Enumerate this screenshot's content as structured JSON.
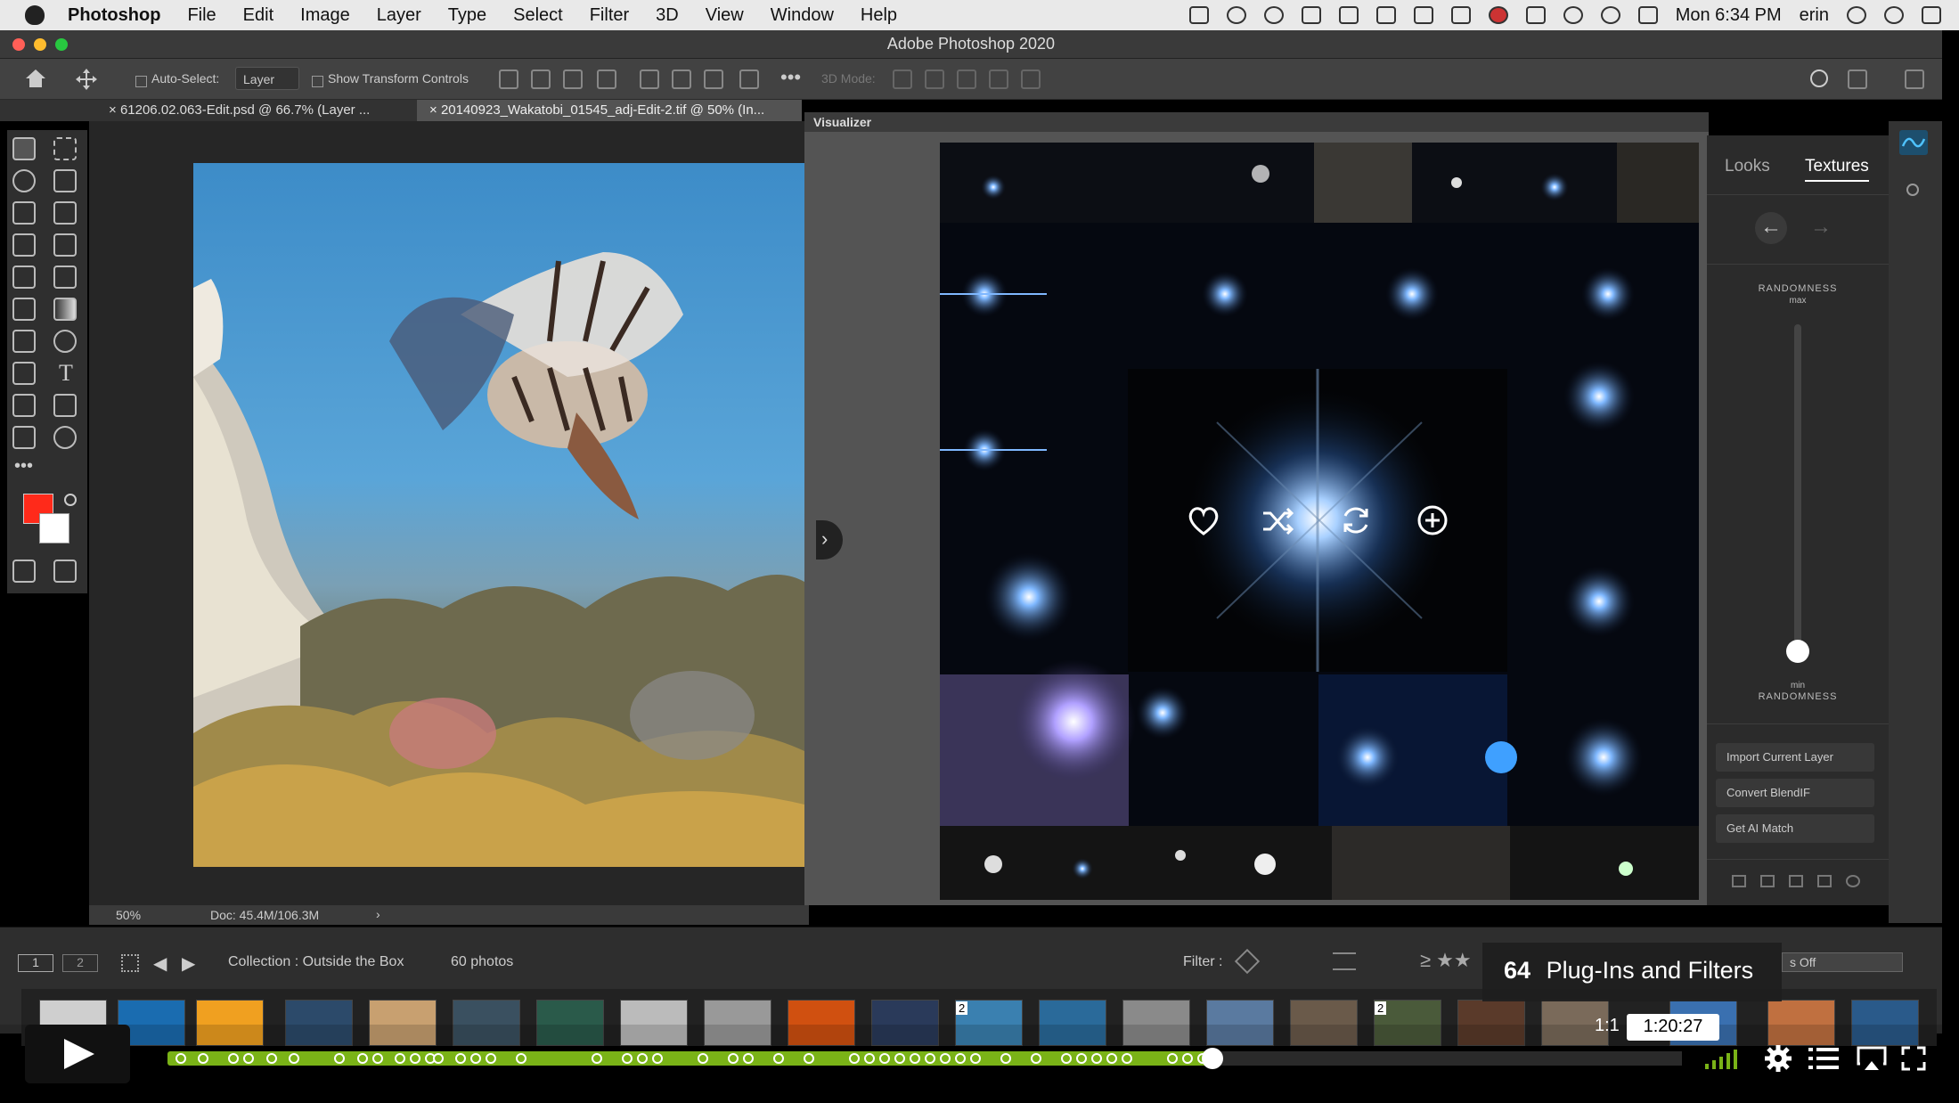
{
  "menubar": {
    "app_name": "Photoshop",
    "items": [
      "File",
      "Edit",
      "Image",
      "Layer",
      "Type",
      "Select",
      "Filter",
      "3D",
      "View",
      "Window",
      "Help"
    ],
    "clock": "Mon 6:34 PM",
    "user": "erin"
  },
  "window": {
    "title": "Adobe Photoshop 2020"
  },
  "options_bar": {
    "auto_select_label": "Auto-Select:",
    "auto_select_value": "Layer",
    "show_transform_label": "Show Transform Controls",
    "mode_3d_label": "3D Mode:"
  },
  "tabs": [
    {
      "label": "61206.02.063-Edit.psd @ 66.7% (Layer ..."
    },
    {
      "label": "20140923_Wakatobi_01545_adj-Edit-2.tif @ 50% (In..."
    }
  ],
  "canvas": {
    "zoom": "50%",
    "doc_size": "Doc: 45.4M/106.3M"
  },
  "visualizer": {
    "title": "Visualizer"
  },
  "side_panel": {
    "tabs": [
      "Looks",
      "Textures"
    ],
    "active_tab": "Textures",
    "randomness_top": "RANDOMNESS",
    "randomness_max": "max",
    "randomness_min": "min",
    "randomness_bottom": "RANDOMNESS",
    "randomness_level": 0.0,
    "buttons": [
      "Import Current Layer",
      "Convert BlendIF",
      "Get AI Match"
    ]
  },
  "filmstrip": {
    "page_1": "1",
    "page_2": "2",
    "collection": "Collection : Outside the Box",
    "photo_count": "60 photos",
    "filter_label": "Filter :",
    "filters_off": "s Off",
    "badge_numbers": [
      "2",
      "2"
    ]
  },
  "player": {
    "chapter_number": "64",
    "chapter_title": "Plug-Ins and Filters",
    "time_elapsed": "1:1",
    "time_tooltip": "1:20:27",
    "progress": 0.69
  },
  "colors": {
    "foreground": "#ff2a1a",
    "background": "#ffffff",
    "progress": "#7ab317",
    "ps_accent": "#31a8ff"
  }
}
